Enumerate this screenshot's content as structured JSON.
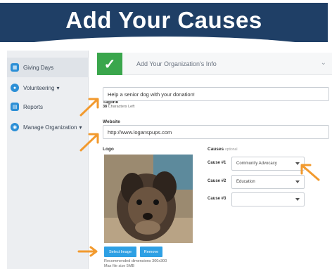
{
  "banner": {
    "title": "Add Your Causes"
  },
  "sidebar": {
    "items": [
      {
        "label": "Giving Days",
        "icon": "calendar-icon"
      },
      {
        "label": "Volunteering",
        "icon": "person-icon",
        "caret": "▾"
      },
      {
        "label": "Reports",
        "icon": "report-icon"
      },
      {
        "label": "Manage Organization",
        "icon": "org-icon",
        "caret": "▾"
      }
    ]
  },
  "step": {
    "title": "Add Your Organization's Info",
    "status": "complete"
  },
  "form": {
    "tagline": {
      "label": "Tagline",
      "value": "Help a senior dog with your donation!",
      "counter_value": "38",
      "counter_text": "Characters Left"
    },
    "website": {
      "label": "Website",
      "value": "http://www.loganspups.com"
    },
    "logo": {
      "label": "Logo",
      "select_button": "Select Image",
      "remove_button": "Remove",
      "hint_dimensions": "Recommended dimensions 300x300",
      "hint_size": "Max file size 5MB"
    },
    "causes": {
      "label": "Causes",
      "optional": "optional",
      "items": [
        {
          "label": "Cause #1",
          "value": "Community Advocacy"
        },
        {
          "label": "Cause #2",
          "value": "Education"
        },
        {
          "label": "Cause #3",
          "value": ""
        }
      ]
    }
  },
  "colors": {
    "banner": "#1f3f66",
    "accent": "#2ea0e4",
    "check": "#3aa64c",
    "arrow": "#f29a2e"
  }
}
